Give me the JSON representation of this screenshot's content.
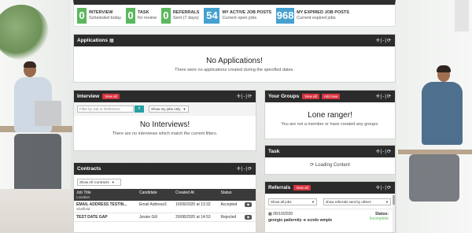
{
  "stats": [
    {
      "num": "0",
      "title": "INTERVIEW",
      "sub": "Scheduled today",
      "color": "#5cb85c"
    },
    {
      "num": "0",
      "title": "TASK",
      "sub": "for review",
      "color": "#5cb85c"
    },
    {
      "num": "0",
      "title": "REFERRALS",
      "sub": "Sent (7 days)",
      "color": "#5cb85c"
    },
    {
      "num": "54",
      "title": "MY ACTIVE JOB POSTS",
      "sub": "Current open jobs",
      "color": "#45a1d0"
    },
    {
      "num": "968",
      "title": "MY EXPIRED JOB POSTS",
      "sub": "Current expired jobs",
      "color": "#45a1d0"
    }
  ],
  "applications": {
    "title": "Applications",
    "tools": "✢|-|⟳",
    "empty_title": "No Applications!",
    "empty_sub": "There were no applications created during the specified dates."
  },
  "interview": {
    "title": "Interview",
    "badge": "View all",
    "tools": "✢|-|⟳",
    "search_placeholder": "Filter by Job or Reference",
    "filter_select": "Show my jobs only",
    "empty_title": "No Interviews!",
    "empty_sub": "There are no interviews which match the current filters."
  },
  "contracts": {
    "title": "Contracts",
    "tools": "✢|-|⟳",
    "filter_select": "Show All Contracts",
    "columns": [
      "Job Title",
      "Candidate",
      "Created At",
      "Status"
    ],
    "job_title_sub": "Location",
    "rows": [
      {
        "job": "EMAIL ADDRESS TESTIN...",
        "location": "Sheffield",
        "candidate": "Email Address3",
        "created": "16/09/2020 at 13:32",
        "status": "Accepted"
      },
      {
        "job": "TEST DATE GAP",
        "location": "",
        "candidate": "Jessie Gill",
        "created": "26/08/2020 at 14:53",
        "status": "Rejected"
      }
    ]
  },
  "groups": {
    "title": "Your Groups",
    "badge_view": "View all",
    "badge_add": "Add new",
    "tools": "✢|-|⟳",
    "empty_title": "Lone ranger!",
    "empty_sub": "You are not a member or have created any groups."
  },
  "task": {
    "title": "Task",
    "tools": "✢|-|⟳",
    "loading": "Loading Content"
  },
  "referrals": {
    "title": "Referrals",
    "badge": "View all",
    "tools": "✢|-|⟳",
    "filter_jobs": "Show all jobs",
    "filter_sent": "show referrals sent by others",
    "date": "05/10/2020",
    "status_label": "Status:",
    "status": "Incomplete",
    "names": "georgio patternity ➜ scndo wmple"
  }
}
